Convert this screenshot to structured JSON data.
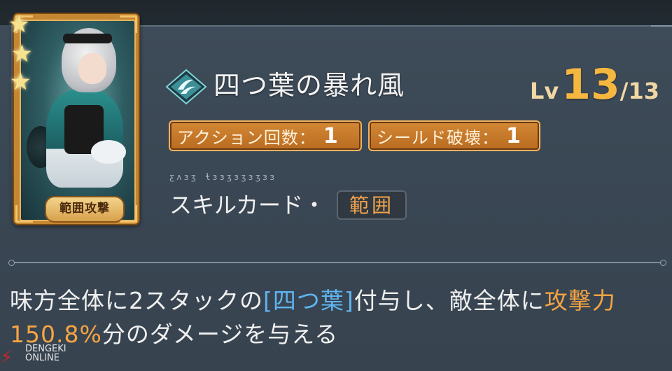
{
  "card": {
    "stars": 3,
    "type_label": "範囲攻撃"
  },
  "skill": {
    "icon": "wind-crest-icon",
    "name": "四つ葉の暴れ風",
    "level_prefix": "Lv",
    "level_current": "13",
    "level_max": "/13"
  },
  "badges": [
    {
      "label": "アクション回数：",
      "value": "1"
    },
    {
      "label": "シールド破壊：",
      "value": "1"
    }
  ],
  "decorative_glyphs": "ƹʌɜʒ  ɬɜɜʒɜʒɜʒɜɜ",
  "card_type": {
    "text": "スキルカード・",
    "tag": "範囲"
  },
  "description": {
    "part1": "味方全体に2スタックの",
    "highlight_blue": "[四つ葉]",
    "part2": "付与し、敵全体に",
    "highlight_orange": "攻撃力150.8%",
    "part3": "分のダメージを与える"
  },
  "watermark": {
    "line1": "DENGEKI",
    "line2": "ONLINE"
  },
  "colors": {
    "accent_gold": "#f5b73f",
    "accent_blue": "#5fb5f1",
    "accent_orange": "#f6a442",
    "badge_fill": "#c97a2a"
  }
}
